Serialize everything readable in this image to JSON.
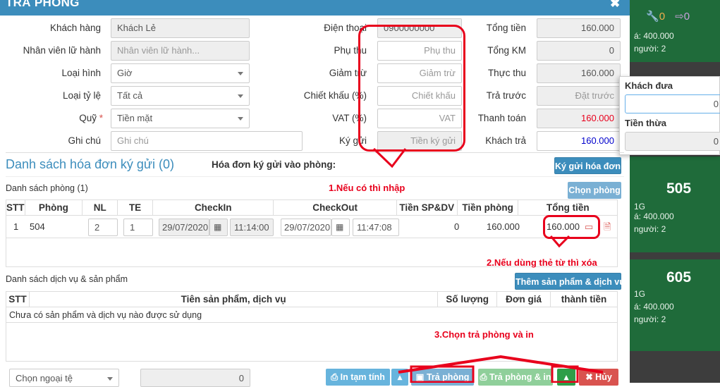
{
  "header": {
    "title": "TRẢ PHÒNG",
    "close": "✖"
  },
  "form_left": {
    "customer": {
      "label": "Khách hàng",
      "value": "Khách Lẻ"
    },
    "guide": {
      "label": "Nhân viên lữ hành",
      "placeholder": "Nhân viên lữ hành..."
    },
    "type": {
      "label": "Loại hình",
      "value": "Giờ"
    },
    "rate_type": {
      "label": "Loại tỷ lệ",
      "value": "Tất cả"
    },
    "fund": {
      "label": "Quỹ",
      "required_mark": "*",
      "value": "Tiền mặt"
    },
    "note": {
      "label": "Ghi chú",
      "placeholder": "Ghi chú"
    }
  },
  "form_mid": {
    "phone": {
      "label": "Điện thoại",
      "value": "0900000000"
    },
    "surcharge": {
      "label": "Phụ thu",
      "placeholder": "Phụ thu"
    },
    "reduction": {
      "label": "Giảm trừ",
      "placeholder": "Giảm trừ"
    },
    "discount": {
      "label": "Chiết khấu (%)",
      "placeholder": "Chiết khấu"
    },
    "vat": {
      "label": "VAT (%)",
      "placeholder": "VAT"
    },
    "deposit": {
      "label": "Ký gửi",
      "placeholder": "Tiền ký gửi"
    }
  },
  "form_right": {
    "total": {
      "label": "Tổng tiền",
      "value": "160.000"
    },
    "total_km": {
      "label": "Tổng KM",
      "value": "0"
    },
    "actual": {
      "label": "Thực thu",
      "value": "160.000"
    },
    "prepaid": {
      "label": "Trả trước",
      "placeholder": "Đặt trước"
    },
    "payment": {
      "label": "Thanh toán",
      "value": "160.000"
    },
    "customer_paid": {
      "label": "Khách trả",
      "value": "160.000"
    }
  },
  "popup": {
    "given_label": "Khách đưa",
    "given_value": "0",
    "change_label": "Tiền thừa",
    "change_value": "0"
  },
  "deposit_section": {
    "title": "Danh sách hóa đơn ký gửi (0)",
    "into_room_label": "Hóa đơn ký gửi vào phòng:",
    "button": "Ký gửi hóa đơn"
  },
  "rooms": {
    "title": "Danh sách phòng (1)",
    "choose_button": "Chọn phòng",
    "columns": [
      "STT",
      "Phòng",
      "NL",
      "TE",
      "CheckIn",
      "CheckOut",
      "Tiền SP&DV",
      "Tiền phòng",
      "Tổng tiền"
    ],
    "row": {
      "stt": "1",
      "room": "504",
      "adults": "2",
      "children": "1",
      "checkin_date": "29/07/2020",
      "checkin_time": "11:14:00",
      "checkout_date": "29/07/2020",
      "checkout_time": "11:47:08",
      "service_total": "0",
      "room_total": "160.000",
      "grand_total": "160.000"
    }
  },
  "services": {
    "title": "Danh sách dịch vụ & sản phẩm",
    "add_button": "Thêm sản phẩm & dịch vụ",
    "columns": [
      "STT",
      "Tiên sản phẩm, dịch vụ",
      "Số lượng",
      "Đơn giá",
      "thành tiền"
    ],
    "empty": "Chưa có sản phẩm và dịch vụ nào được sử dụng"
  },
  "footer": {
    "currency_select": "Chọn ngoại tệ",
    "currency_value": "0",
    "print_temp": "In tạm tính",
    "checkout": "Trả phòng",
    "checkout_print": "Trả phòng & in",
    "cancel": "Hủy"
  },
  "annotations": {
    "note1": "1.Nếu có thì nhập",
    "note2": "2.Nếu dùng thẻ từ thì xóa",
    "note3": "3.Chọn trả phòng và in"
  },
  "background": {
    "icon_count_1": "0",
    "icon_count_2": "0",
    "card_top": {
      "price": "á: 400.000",
      "people": "người: 2"
    },
    "card_505": {
      "number": "505",
      "tag": "1G",
      "price": "á: 400.000",
      "people": "người: 2"
    },
    "card_605": {
      "number": "605",
      "tag": "1G",
      "price": "á: 400.000",
      "people": "người: 2"
    }
  },
  "colors": {
    "primary": "#3c8dbc",
    "annotation_red": "#e8001c",
    "danger": "#d9534f",
    "success": "#2e9e48"
  }
}
